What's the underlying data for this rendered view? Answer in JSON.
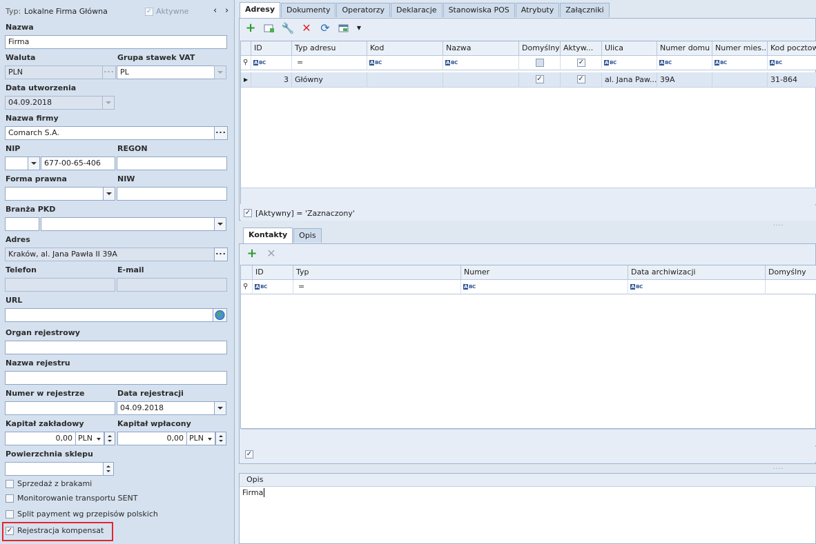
{
  "header": {
    "type_label": "Typ:",
    "type_value": "Lokalne Firma Główna",
    "active_label": "Aktywne",
    "active_checked": true
  },
  "form": {
    "nazwa_label": "Nazwa",
    "nazwa_value": "Firma",
    "waluta_label": "Waluta",
    "waluta_value": "PLN",
    "vat_label": "Grupa stawek VAT",
    "vat_value": "PL",
    "data_utw_label": "Data utworzenia",
    "data_utw_value": "04.09.2018",
    "nazwa_firmy_label": "Nazwa firmy",
    "nazwa_firmy_value": "Comarch S.A.",
    "nip_label": "NIP",
    "nip_prefix": "",
    "nip_value": "677-00-65-406",
    "regon_label": "REGON",
    "regon_value": "",
    "forma_label": "Forma prawna",
    "forma_value": "",
    "niw_label": "NIW",
    "niw_value": "",
    "branza_label": "Branża PKD",
    "branza_code": "",
    "branza_value": "",
    "adres_label": "Adres",
    "adres_value": "Kraków, al. Jana Pawła II 39A",
    "telefon_label": "Telefon",
    "telefon_value": "",
    "email_label": "E-mail",
    "email_value": "",
    "url_label": "URL",
    "url_value": "",
    "organ_label": "Organ rejestrowy",
    "organ_value": "",
    "nazwa_rej_label": "Nazwa rejestru",
    "nazwa_rej_value": "",
    "numer_rej_label": "Numer w rejestrze",
    "numer_rej_value": "",
    "data_rej_label": "Data rejestracji",
    "data_rej_value": "04.09.2018",
    "kap_zakl_label": "Kapitał zakładowy",
    "kap_zakl_value": "0,00",
    "kap_zakl_cur": "PLN",
    "kap_wpl_label": "Kapitał wpłacony",
    "kap_wpl_value": "0,00",
    "kap_wpl_cur": "PLN",
    "pow_label": "Powierzchnia sklepu",
    "pow_value": "",
    "checks": [
      {
        "label": "Sprzedaż z brakami",
        "checked": false
      },
      {
        "label": "Monitorowanie transportu SENT",
        "checked": false
      },
      {
        "label": "Split payment wg przepisów polskich",
        "checked": false
      },
      {
        "label": "Rejestracja kompensat",
        "checked": true
      }
    ]
  },
  "tabs": [
    "Adresy",
    "Dokumenty",
    "Operatorzy",
    "Deklaracje",
    "Stanowiska POS",
    "Atrybuty",
    "Załączniki"
  ],
  "adresy": {
    "columns": [
      "ID",
      "Typ adresu",
      "Kod",
      "Nazwa",
      "Domyślny",
      "Aktyw...",
      "Ulica",
      "Numer domu",
      "Numer mies...",
      "Kod pocztow"
    ],
    "row": {
      "id": "3",
      "typ": "Główny",
      "kod": "",
      "nazwa": "",
      "domyslny": true,
      "aktywny": true,
      "ulica": "al. Jana Paw...",
      "numer_domu": "39A",
      "numer_mies": "",
      "kod_pocztowy": "31-864"
    },
    "filter_text": "[Aktywny] = 'Zaznaczony'"
  },
  "subtabs": [
    "Kontakty",
    "Opis"
  ],
  "kontakty": {
    "columns": [
      "ID",
      "Typ",
      "Numer",
      "Data archiwizacji",
      "Domyślny"
    ]
  },
  "opis": {
    "label": "Opis",
    "text": "Firma"
  },
  "colors": {
    "accent": "#2f5597",
    "highlight": "#e2262c",
    "panel_bg": "#d5e1ef"
  }
}
